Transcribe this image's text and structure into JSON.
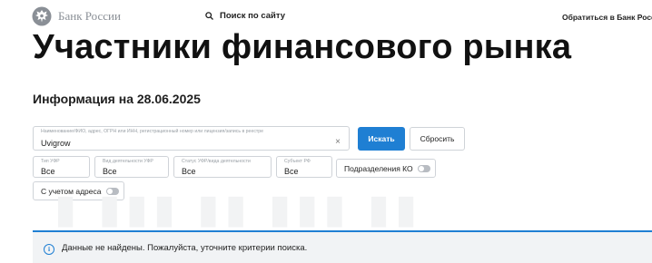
{
  "header": {
    "logo_text": "Банк России",
    "search_label": "Поиск по сайту",
    "contact_label": "Обратиться в Банк России"
  },
  "page": {
    "title": "Участники финансового рынка",
    "info_date": "Информация на 28.06.2025"
  },
  "filters": {
    "search": {
      "label": "Наименование/ФИО, адрес, ОГРН или ИНН, регистрационный номер или лицензия/запись в реестре",
      "value": "Uvigrow",
      "clear_icon": "×"
    },
    "search_button": "Искать",
    "reset_button": "Сбросить",
    "type": {
      "label": "Тип УФР",
      "value": "Все"
    },
    "activity": {
      "label": "Вид деятельности УФР",
      "value": "Все"
    },
    "status": {
      "label": "Статус УФР/вида деятельности",
      "value": "Все"
    },
    "region": {
      "label": "Субъект РФ",
      "value": "Все"
    },
    "ko_divisions": {
      "label": "Подразделения КО",
      "on": false
    },
    "with_address": {
      "label": "С учетом адреса",
      "on": false
    }
  },
  "notice": {
    "icon": "info-icon",
    "text": "Данные не найдены. Пожалуйста, уточните критерии поиска."
  },
  "colors": {
    "accent": "#1f7fd3",
    "notice_bg": "#f1f3f5",
    "border": "#cfd3d8"
  }
}
